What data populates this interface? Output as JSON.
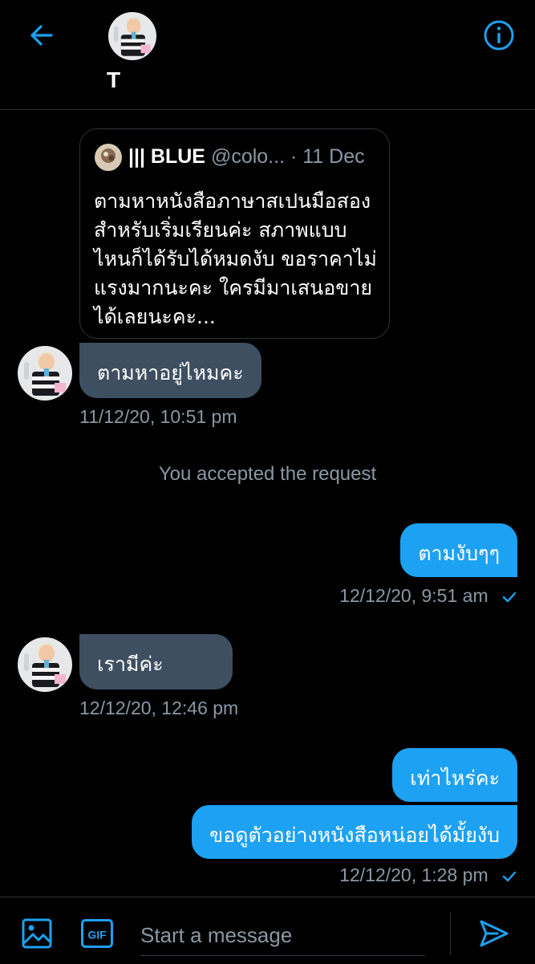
{
  "header": {
    "name": "T",
    "back_icon": "arrow-left-icon",
    "info_icon": "info-icon"
  },
  "quoted_tweet": {
    "name": "||| BLUE",
    "handle": "@colo...",
    "date": "· 11 Dec",
    "text": "ตามหาหนังสือภาษาสเปนมือสองสำหรับเริ่มเรียนค่ะ สภาพแบบไหนก็ได้รับได้หมดงับ ขอราคาไม่แรงมากนะคะ ใครมีมาเสนอขายได้เลยนะคะ..."
  },
  "messages": {
    "m1": {
      "text": "ตามหาอยู่ไหมคะ",
      "time": "11/12/20, 10:51 pm"
    },
    "system": "You accepted the request",
    "m2": {
      "text": "ตามงับๆๆ",
      "time": "12/12/20, 9:51 am"
    },
    "m3": {
      "text": "เรามีค่ะ",
      "time": "12/12/20, 12:46 pm"
    },
    "m4": {
      "text": "เท่าไหร่คะ"
    },
    "m5": {
      "text": "ขอดูตัวอย่างหนังสือหน่อยได้มั้ยงับ",
      "time": "12/12/20, 1:28 pm"
    }
  },
  "composer": {
    "placeholder": "Start a message",
    "gif_label": "GIF"
  },
  "colors": {
    "accent": "#1da1f2",
    "incoming_bubble": "#3d4f61",
    "muted": "#8b98a5"
  }
}
